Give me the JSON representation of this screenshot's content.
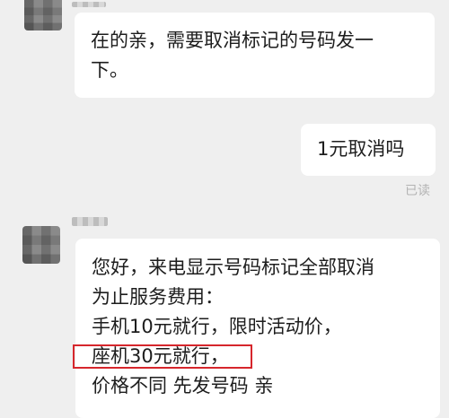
{
  "messages": [
    {
      "direction": "incoming",
      "lines": [
        "在的亲，需要取消标记的号码发一",
        "下。"
      ]
    },
    {
      "direction": "outgoing",
      "text": "1元取消吗",
      "status": "已读"
    },
    {
      "direction": "incoming",
      "lines": [
        "您好，来电显示号码标记全部取消",
        "为止服务费用：",
        "手机10元就行，限时活动价，",
        "座机30元就行，",
        "价格不同 先发号码 亲"
      ]
    }
  ],
  "colors": {
    "background": "#efefef",
    "bubble": "#ffffff",
    "text": "#1d1d1d",
    "read_status": "#b3b3b3",
    "highlight": "#d6262c"
  }
}
